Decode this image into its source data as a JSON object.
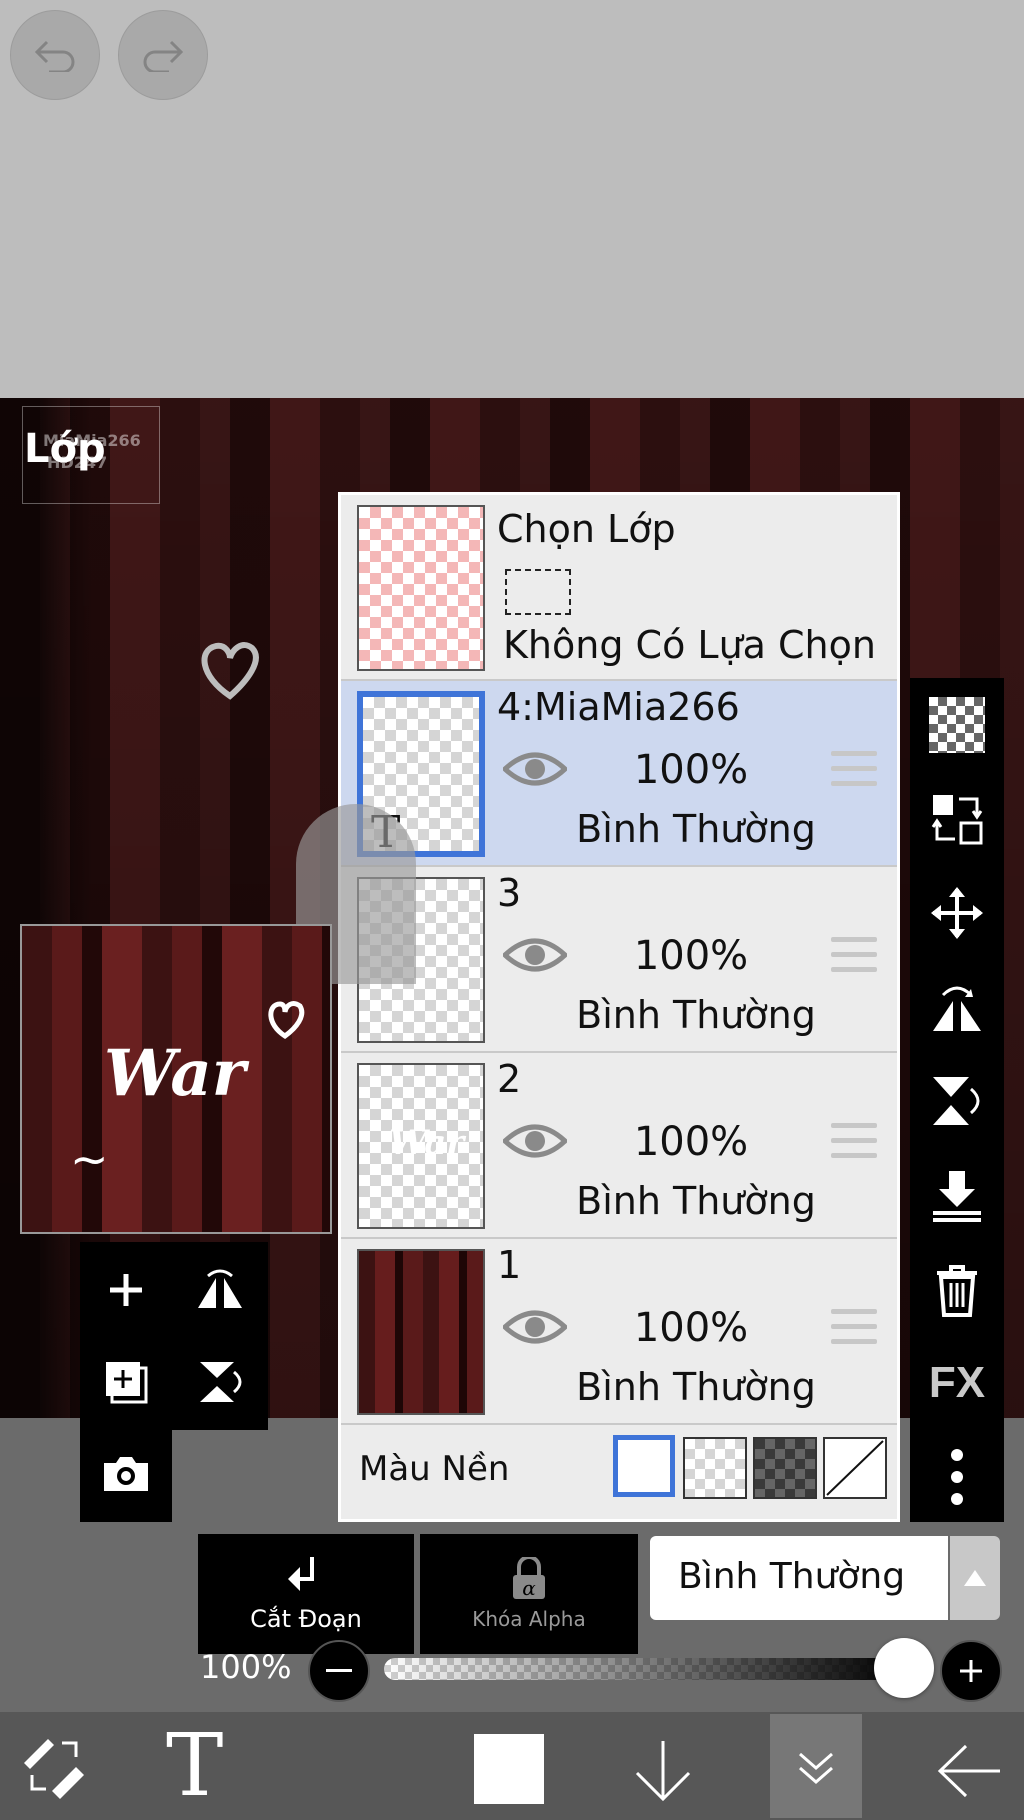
{
  "panel": {
    "title": "Lớp"
  },
  "watermark": {
    "line1": "MiaMia266",
    "line2": "HĐ247"
  },
  "selection_layer": {
    "title": "Chọn Lớp",
    "status": "Không Có Lựa Chọn"
  },
  "layers": [
    {
      "name": "4:MiaMia266",
      "opacity": "100%",
      "blend": "Bình Thường",
      "selected": true,
      "thumb_label": "T"
    },
    {
      "name": "3",
      "opacity": "100%",
      "blend": "Bình Thường",
      "selected": false
    },
    {
      "name": "2",
      "opacity": "100%",
      "blend": "Bình Thường",
      "selected": false
    },
    {
      "name": "1",
      "opacity": "100%",
      "blend": "Bình Thường",
      "selected": false
    }
  ],
  "background": {
    "label": "Màu Nền",
    "options": [
      "white",
      "checker",
      "dark-checker",
      "none"
    ],
    "selected": "white"
  },
  "preview": {
    "text": "War"
  },
  "actions": {
    "clip_label": "Cắt Đoạn",
    "alpha_lock_label": "Khóa Alpha",
    "blend_mode": "Bình Thường"
  },
  "opacity_slider": {
    "label": "100%",
    "value": 1.0
  },
  "colors": {
    "accent": "#3f74d8",
    "selected_row": "#cdd8ef",
    "panel": "#ececec"
  }
}
